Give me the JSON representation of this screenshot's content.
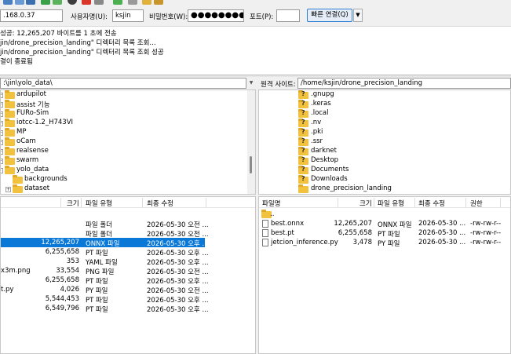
{
  "quickconnect": {
    "host_value": ".168.0.37",
    "user_label": "사용자명(U):",
    "user_value": "ksjin",
    "pass_label": "비밀번호(W):",
    "pass_value": "●●●●●●●●",
    "port_label": "포트(P):",
    "port_value": "",
    "connect_label": "빠른 연결(Q)",
    "dropdown_glyph": "▼"
  },
  "log": [
    "성공: 12,265,207 바이트를 1 초에 전송",
    "jin/drone_precision_landing\" 디렉터리 목록 조회...",
    "jin/drone_precision_landing\" 디렉터리 목록 조회 성공",
    "결이 종료됨"
  ],
  "local_site": {
    "path": ":\\jin\\yolo_data\\",
    "tree": [
      {
        "name": "ardupilot",
        "expander": "+"
      },
      {
        "name": "assist 기능",
        "expander": "+"
      },
      {
        "name": "FURo-Sim",
        "expander": "+"
      },
      {
        "name": "iotcc-1.2_H743VI",
        "expander": "+"
      },
      {
        "name": "MP",
        "expander": "+"
      },
      {
        "name": "oCam",
        "expander": "+"
      },
      {
        "name": "realsense",
        "expander": "+"
      },
      {
        "name": "swarm",
        "expander": "+"
      },
      {
        "name": "yolo_data",
        "expander": "-"
      },
      {
        "name": "backgrounds",
        "expander": ""
      },
      {
        "name": "dataset",
        "expander": "+"
      }
    ]
  },
  "remote_site": {
    "label": "원격 사이트:",
    "path": "/home/ksjin/drone_precision_landing",
    "tree": [
      {
        "name": ".gnupg",
        "type": "unknown"
      },
      {
        "name": ".keras",
        "type": "unknown"
      },
      {
        "name": ".local",
        "type": "unknown"
      },
      {
        "name": ".nv",
        "type": "unknown"
      },
      {
        "name": ".pki",
        "type": "unknown"
      },
      {
        "name": ".ssr",
        "type": "unknown"
      },
      {
        "name": "darknet",
        "type": "unknown"
      },
      {
        "name": "Desktop",
        "type": "unknown"
      },
      {
        "name": "Documents",
        "type": "unknown"
      },
      {
        "name": "Downloads",
        "type": "unknown"
      },
      {
        "name": "drone_precision_landing",
        "type": "folder"
      }
    ]
  },
  "local_list": {
    "headers": {
      "size": "크기",
      "type": "파일 유형",
      "modified": "최종 수정"
    },
    "rows": [
      {
        "name": "",
        "size": "",
        "type": "파일 폴더",
        "modified": "2026-05-30 오전 ...",
        "selected": false
      },
      {
        "name": "",
        "size": "",
        "type": "파일 폴더",
        "modified": "2026-05-30 오전 ...",
        "selected": false
      },
      {
        "name": "",
        "size": "12,265,207",
        "type": "ONNX 파일",
        "modified": "2026-05-30 오후 ...",
        "selected": true
      },
      {
        "name": "",
        "size": "6,255,658",
        "type": "PT 파일",
        "modified": "2026-05-30 오후 ...",
        "selected": false
      },
      {
        "name": "",
        "size": "353",
        "type": "YAML 파일",
        "modified": "2026-05-30 오후 ...",
        "selected": false
      },
      {
        "name": "x3m.png",
        "size": "33,554",
        "type": "PNG 파일",
        "modified": "2026-05-30 오전 ...",
        "selected": false
      },
      {
        "name": "",
        "size": "6,255,658",
        "type": "PT 파일",
        "modified": "2026-05-30 오후 ...",
        "selected": false
      },
      {
        "name": "t.py",
        "size": "4,026",
        "type": "PY 파일",
        "modified": "2026-05-30 오전 ...",
        "selected": false
      },
      {
        "name": "",
        "size": "5,544,453",
        "type": "PT 파일",
        "modified": "2026-05-30 오후 ...",
        "selected": false
      },
      {
        "name": "",
        "size": "6,549,796",
        "type": "PT 파일",
        "modified": "2026-05-30 오후 ...",
        "selected": false
      }
    ]
  },
  "remote_list": {
    "headers": {
      "name": "파일명",
      "size": "크기",
      "type": "파일 유형",
      "modified": "최종 수정",
      "perm": "권한"
    },
    "rows": [
      {
        "name": "..",
        "size": "",
        "type": "",
        "modified": "",
        "perm": "",
        "icon": "folder"
      },
      {
        "name": "best.onnx",
        "size": "12,265,207",
        "type": "ONNX 파일",
        "modified": "2026-05-30 ...",
        "perm": "-rw-rw-r--",
        "icon": "file"
      },
      {
        "name": "best.pt",
        "size": "6,255,658",
        "type": "PT 파일",
        "modified": "2026-05-30 ...",
        "perm": "-rw-rw-r--",
        "icon": "file"
      },
      {
        "name": "jetcion_inference.py",
        "size": "3,478",
        "type": "PY 파일",
        "modified": "2026-05-30 ...",
        "perm": "-rw-rw-r--",
        "icon": "file"
      }
    ]
  },
  "colors": {
    "selection": "#0a78d7",
    "folder": "#f2c13d",
    "accent_border": "#2d7dd2"
  }
}
